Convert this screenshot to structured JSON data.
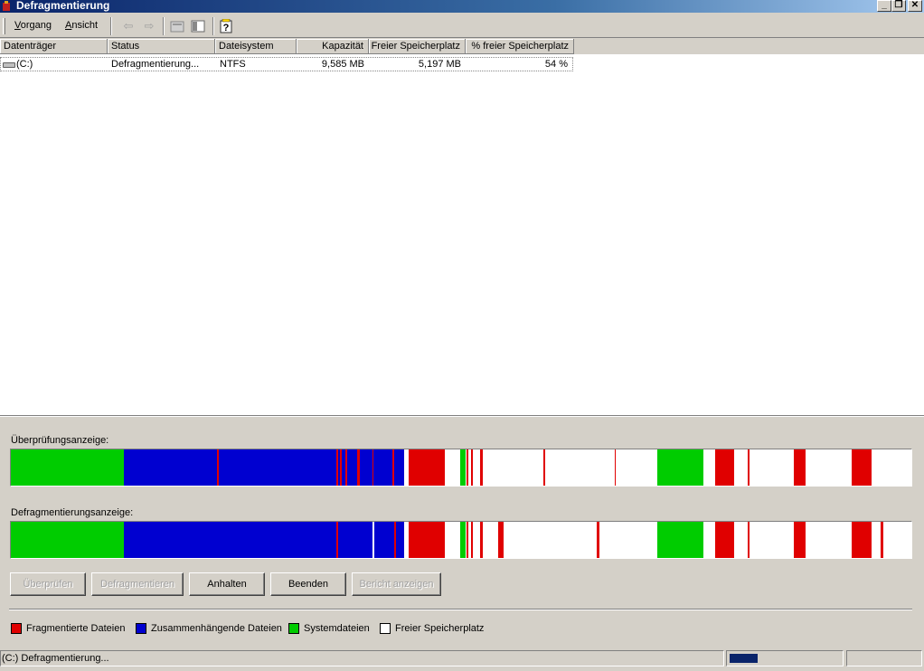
{
  "window": {
    "title": "Defragmentierung",
    "minimize": "_",
    "restore": "❐",
    "close": "✕"
  },
  "menu": {
    "items": [
      "Vorgang",
      "Ansicht"
    ]
  },
  "toolbar": {
    "back_icon": "arrow-left-icon",
    "forward_icon": "arrow-right-icon",
    "properties_icon": "properties-icon",
    "view_icon": "view-icon",
    "help_icon": "help-icon"
  },
  "list": {
    "columns": [
      "Datenträger",
      "Status",
      "Dateisystem",
      "Kapazität",
      "Freier Speicherplatz",
      "% freier Speicherplatz"
    ],
    "rows": [
      {
        "drive": "(C:)",
        "status": "Defragmentierung...",
        "filesystem": "NTFS",
        "capacity": "9,585 MB",
        "free": "5,197 MB",
        "free_pct": "54 %"
      }
    ]
  },
  "analysis": {
    "label": "Überprüfungsanzeige:"
  },
  "defrag": {
    "label": "Defragmentierungsanzeige:"
  },
  "buttons": {
    "analyze": "Überprüfen",
    "defragment": "Defragmentieren",
    "pause": "Anhalten",
    "stop": "Beenden",
    "report": "Bericht anzeigen"
  },
  "legend": [
    {
      "label": "Fragmentierte Dateien",
      "color": "#e00000"
    },
    {
      "label": "Zusammenhängende Dateien",
      "color": "#0000d0"
    },
    {
      "label": "Systemdateien",
      "color": "#00cc00"
    },
    {
      "label": "Freier Speicherplatz",
      "color": "#ffffff"
    }
  ],
  "status": {
    "text": "(C:) Defragmentierung...",
    "progress": 0.25
  }
}
